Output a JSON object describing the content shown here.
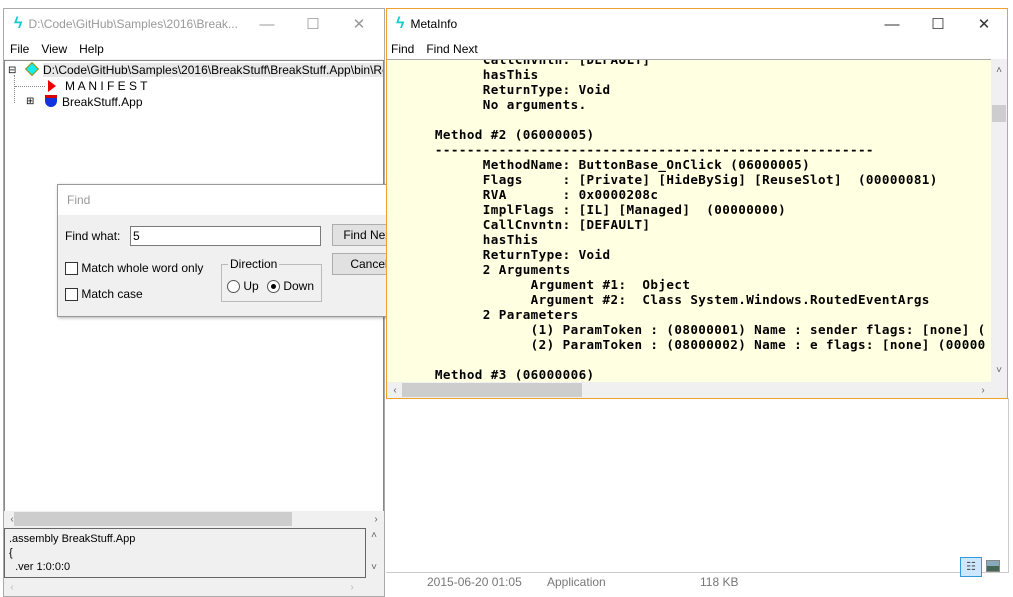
{
  "explorer_bg": {
    "row": {
      "date": "2015-06-20 01:05",
      "type": "Application",
      "size": "118 KB"
    },
    "view_buttons": [
      "details-view-icon",
      "large-icons-view-icon"
    ]
  },
  "left_window": {
    "title": "D:\\Code\\GitHub\\Samples\\2016\\Break...",
    "menu": [
      "File",
      "View",
      "Help"
    ],
    "tree": {
      "root": "D:\\Code\\GitHub\\Samples\\2016\\BreakStuff\\BreakStuff.App\\bin\\Release",
      "children": [
        "M A N I F E S T",
        "BreakStuff.App"
      ]
    },
    "bottom_text": [
      ".assembly BreakStuff.App",
      "{",
      "  .ver 1:0:0:0"
    ]
  },
  "find_dialog": {
    "title": "Find",
    "find_what_label": "Find what:",
    "find_what_value": "5",
    "match_whole_word": {
      "label": "Match whole word only",
      "checked": false
    },
    "match_case": {
      "label": "Match case",
      "checked": false
    },
    "direction_label": "Direction",
    "up_label": "Up",
    "down_label": "Down",
    "direction": "Down",
    "find_next": "Find Next",
    "cancel": "Cancel"
  },
  "metainfo": {
    "title": "MetaInfo",
    "menu": [
      "Find",
      "Find Next"
    ],
    "accent": "#f0a030",
    "background": "#ffffe1",
    "lines": [
      "            CallCnvntn: [DEFAULT]",
      "            hasThis",
      "            ReturnType: Void",
      "            No arguments.",
      "",
      "      Method #2 (06000005)",
      "      -------------------------------------------------------",
      "            MethodName: ButtonBase_OnClick (06000005)",
      "            Flags     : [Private] [HideBySig] [ReuseSlot]  (00000081)",
      "            RVA       : 0x0000208c",
      "            ImplFlags : [IL] [Managed]  (00000000)",
      "            CallCnvntn: [DEFAULT]",
      "            hasThis",
      "            ReturnType: Void",
      "            2 Arguments",
      "                  Argument #1:  Object",
      "                  Argument #2:  Class System.Windows.RoutedEventArgs",
      "            2 Parameters",
      "                  (1) ParamToken : (08000001) Name : sender flags: [none] (",
      "                  (2) ParamToken : (08000002) Name : e flags: [none] (00000",
      "",
      "      Method #3 (06000006)"
    ]
  }
}
